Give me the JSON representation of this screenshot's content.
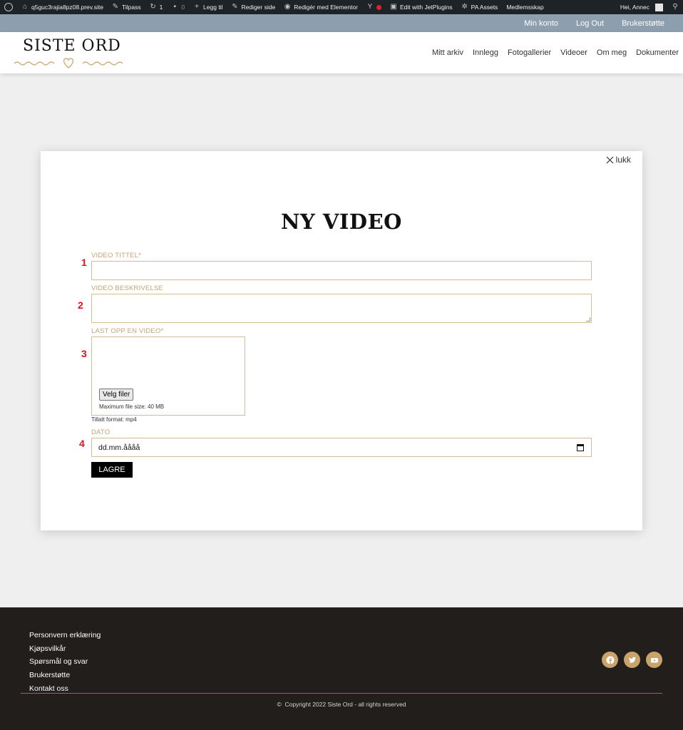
{
  "adminbar": {
    "site": "q5guc3rajia8pz08.prev.site",
    "customize": "Tilpass",
    "updates_count": "1",
    "comments_count": "0",
    "add_new": "Legg til",
    "edit_page": "Rediger side",
    "edit_elementor": "Redigér med Elementor",
    "jetplugins": "Edit with JetPlugins",
    "pa_assets": "PA Assets",
    "membership": "Medlemsskap",
    "greeting": "Hei, Annec"
  },
  "userbar": {
    "items": [
      "Min konto",
      "Log Out",
      "Brukerstøtte"
    ]
  },
  "header": {
    "logo": "SISTE ORD",
    "nav": [
      "Mitt arkiv",
      "Innlegg",
      "Fotogallerier",
      "Videoer",
      "Om meg",
      "Dokumenter"
    ]
  },
  "modal": {
    "close_label": "lukk",
    "title": "NY VIDEO",
    "fields": {
      "title_label": "VIDEO TITTEL*",
      "description_label": "VIDEO BESKRIVELSE",
      "upload_label": "LAST OPP EN VIDEO*",
      "upload_button": "Velg filer",
      "upload_hint": "Maximum file size: 40 MB",
      "format_hint": "Tillatt format: mp4",
      "date_label": "DATO",
      "date_placeholder": "dd.mm.åååå"
    },
    "markers": [
      "1",
      "2",
      "3",
      "4"
    ],
    "save_button": "LAGRE"
  },
  "footer": {
    "links": [
      "Personvern erklæring",
      "Kjøpsvilkår",
      "Spørsmål og svar",
      "Brukerstøtte",
      "Kontakt oss"
    ],
    "social": [
      "facebook-icon",
      "twitter-icon",
      "youtube-icon"
    ],
    "copyright": "Copyright 2022 Siste Ord - all rights reserved"
  },
  "colors": {
    "accent_gold": "#c9a46a",
    "label_gold": "#c9a174",
    "marker_red": "#e0101c",
    "userbar": "#8d9fae",
    "footer_bg": "#211e1c"
  }
}
